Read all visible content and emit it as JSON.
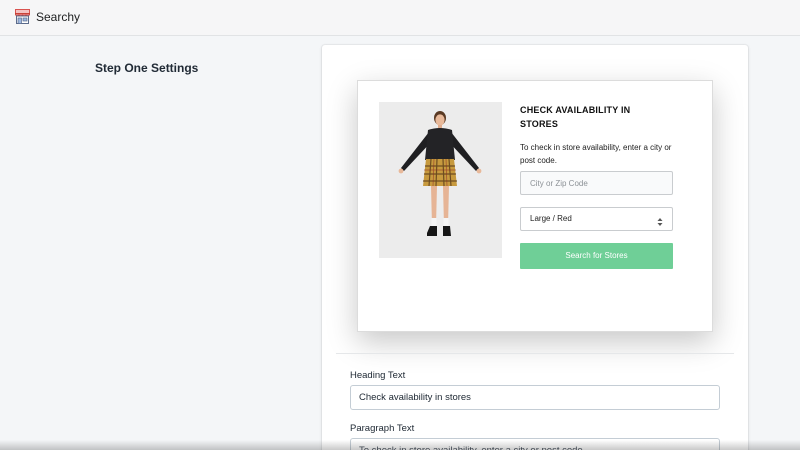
{
  "app": {
    "title": "Searchy",
    "logo_icon": "storefront-icon"
  },
  "section": {
    "title": "Step One Settings"
  },
  "preview": {
    "product_image": "model-in-plaid-skirt-photo",
    "heading": "CHECK AVAILABILITY IN STORES",
    "paragraph": "To check in store availability, enter a city or post code.",
    "city_placeholder": "City or Zip Code",
    "variant_selected": "Large / Red",
    "button_label": "Search for Stores",
    "button_color": "#6fcf97"
  },
  "form": {
    "heading_label": "Heading Text",
    "heading_value": "Check availability in stores",
    "paragraph_label": "Paragraph Text",
    "paragraph_value": "To check in store availability, enter a city or post code"
  }
}
